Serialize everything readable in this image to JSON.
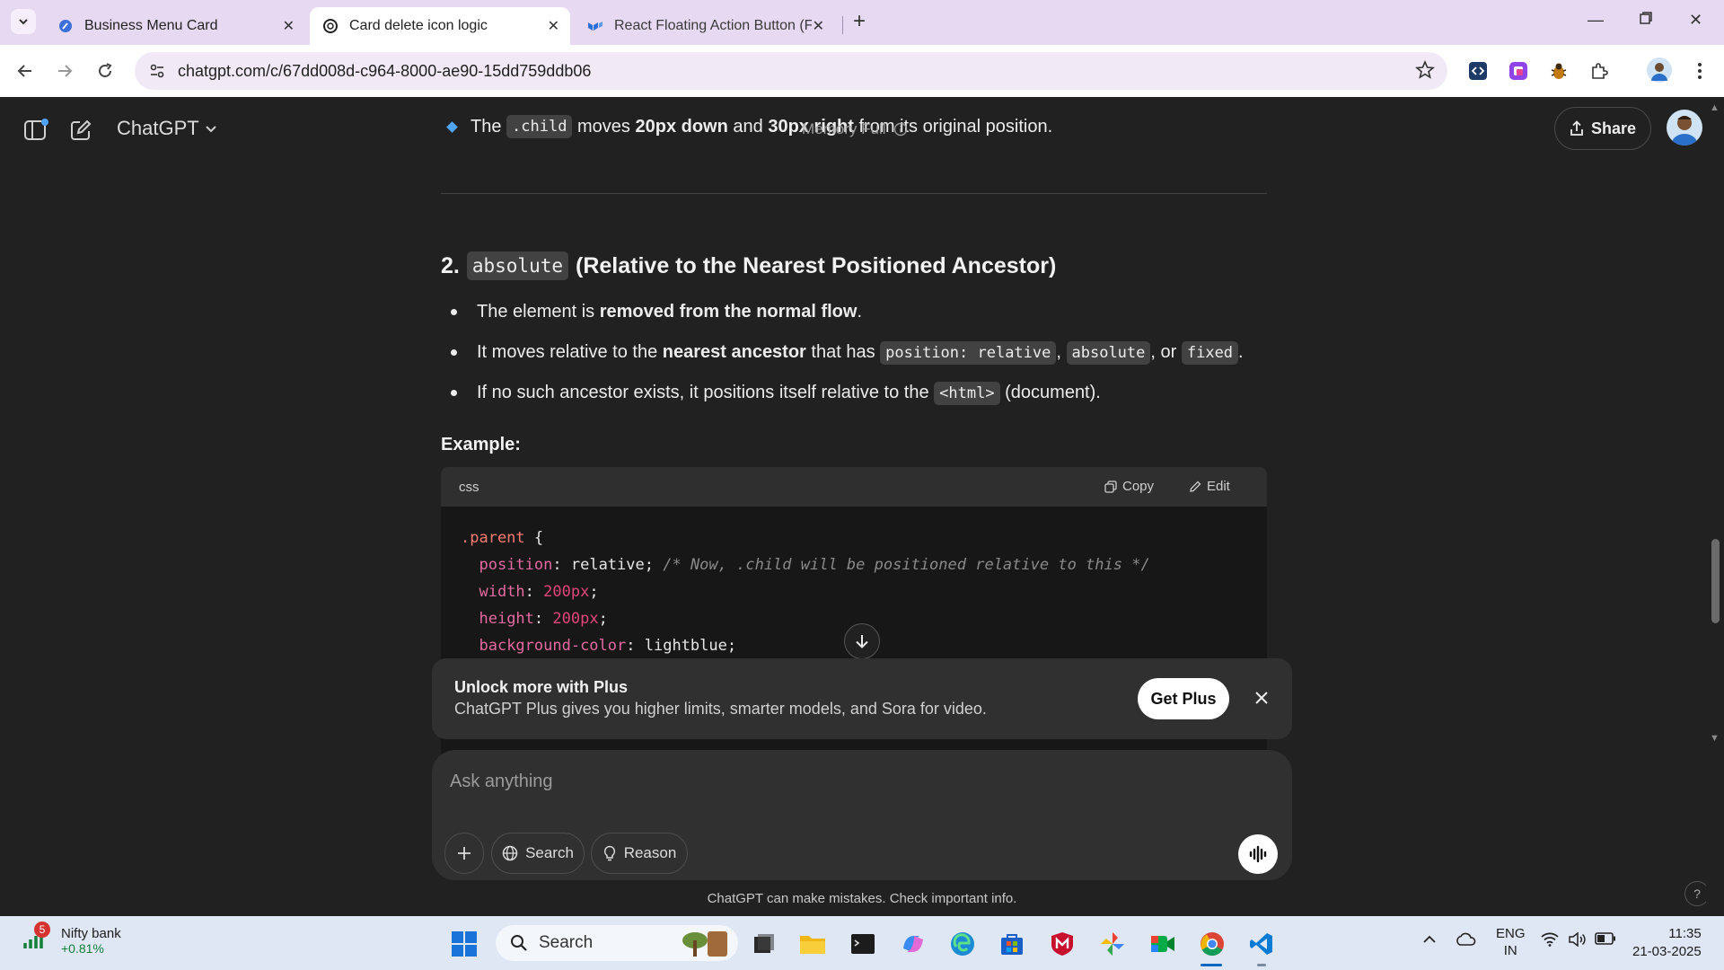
{
  "browser": {
    "tabs": [
      {
        "title": "Business Menu Card",
        "active": false
      },
      {
        "title": "Card delete icon logic",
        "active": true
      },
      {
        "title": "React Floating Action Button (F/",
        "active": false
      }
    ],
    "url": "chatgpt.com/c/67dd008d-c964-8000-ae90-15dd759ddb06"
  },
  "header": {
    "model": "ChatGPT",
    "memory_status": "Memory Full",
    "share_label": "Share"
  },
  "content": {
    "top_bullet": {
      "pre": "The",
      "code": ".child",
      "mid": "moves",
      "bold1": "20px down",
      "and": "and",
      "bold2": "30px right",
      "post": "from its original position."
    },
    "heading": {
      "number": "2.",
      "code": "absolute",
      "text": "(Relative to the Nearest Positioned Ancestor)"
    },
    "bullets": {
      "b1_pre": "The element is",
      "b1_bold": "removed from the normal flow",
      "b1_post": ".",
      "b2_pre": "It moves relative to the",
      "b2_bold": "nearest ancestor",
      "b2_mid": "that has",
      "b2_code1": "position: relative",
      "b2_sep1": ",",
      "b2_code2": "absolute",
      "b2_sep2": ", or",
      "b2_code3": "fixed",
      "b2_post": ".",
      "b3_pre": "If no such ancestor exists, it positions itself relative to the",
      "b3_code": "<html>",
      "b3_post": "(document)."
    },
    "example_label": "Example:",
    "code_block": {
      "language": "css",
      "copy_label": "Copy",
      "edit_label": "Edit",
      "line1_selector": ".parent",
      "line1_brace": " {",
      "line2_prop": "position",
      "line2_val": "relative;",
      "line2_comment": "/* Now, .child will be positioned relative to this */",
      "line3_prop": "width",
      "line3_val": "200px",
      "line4_prop": "height",
      "line4_val": "200px",
      "line5_prop": "background-color",
      "line5_val": "lightblue;"
    }
  },
  "upsell": {
    "title": "Unlock more with Plus",
    "description": "ChatGPT Plus gives you higher limits, smarter models, and Sora for video.",
    "button": "Get Plus"
  },
  "composer": {
    "placeholder": "Ask anything",
    "search_label": "Search",
    "reason_label": "Reason"
  },
  "disclaimer": "ChatGPT can make mistakes. Check important info.",
  "help": "?",
  "taskbar": {
    "widget_badge": "5",
    "widget_title": "Nifty bank",
    "widget_value": "+0.81%",
    "search_label": "Search",
    "lang_top": "ENG",
    "lang_bottom": "IN",
    "time": "11:35",
    "date": "21-03-2025"
  },
  "colors": {
    "accent_blue": "#4ea3f2",
    "page_bg": "#212121",
    "tabbar_bg": "#e8d9f3"
  }
}
